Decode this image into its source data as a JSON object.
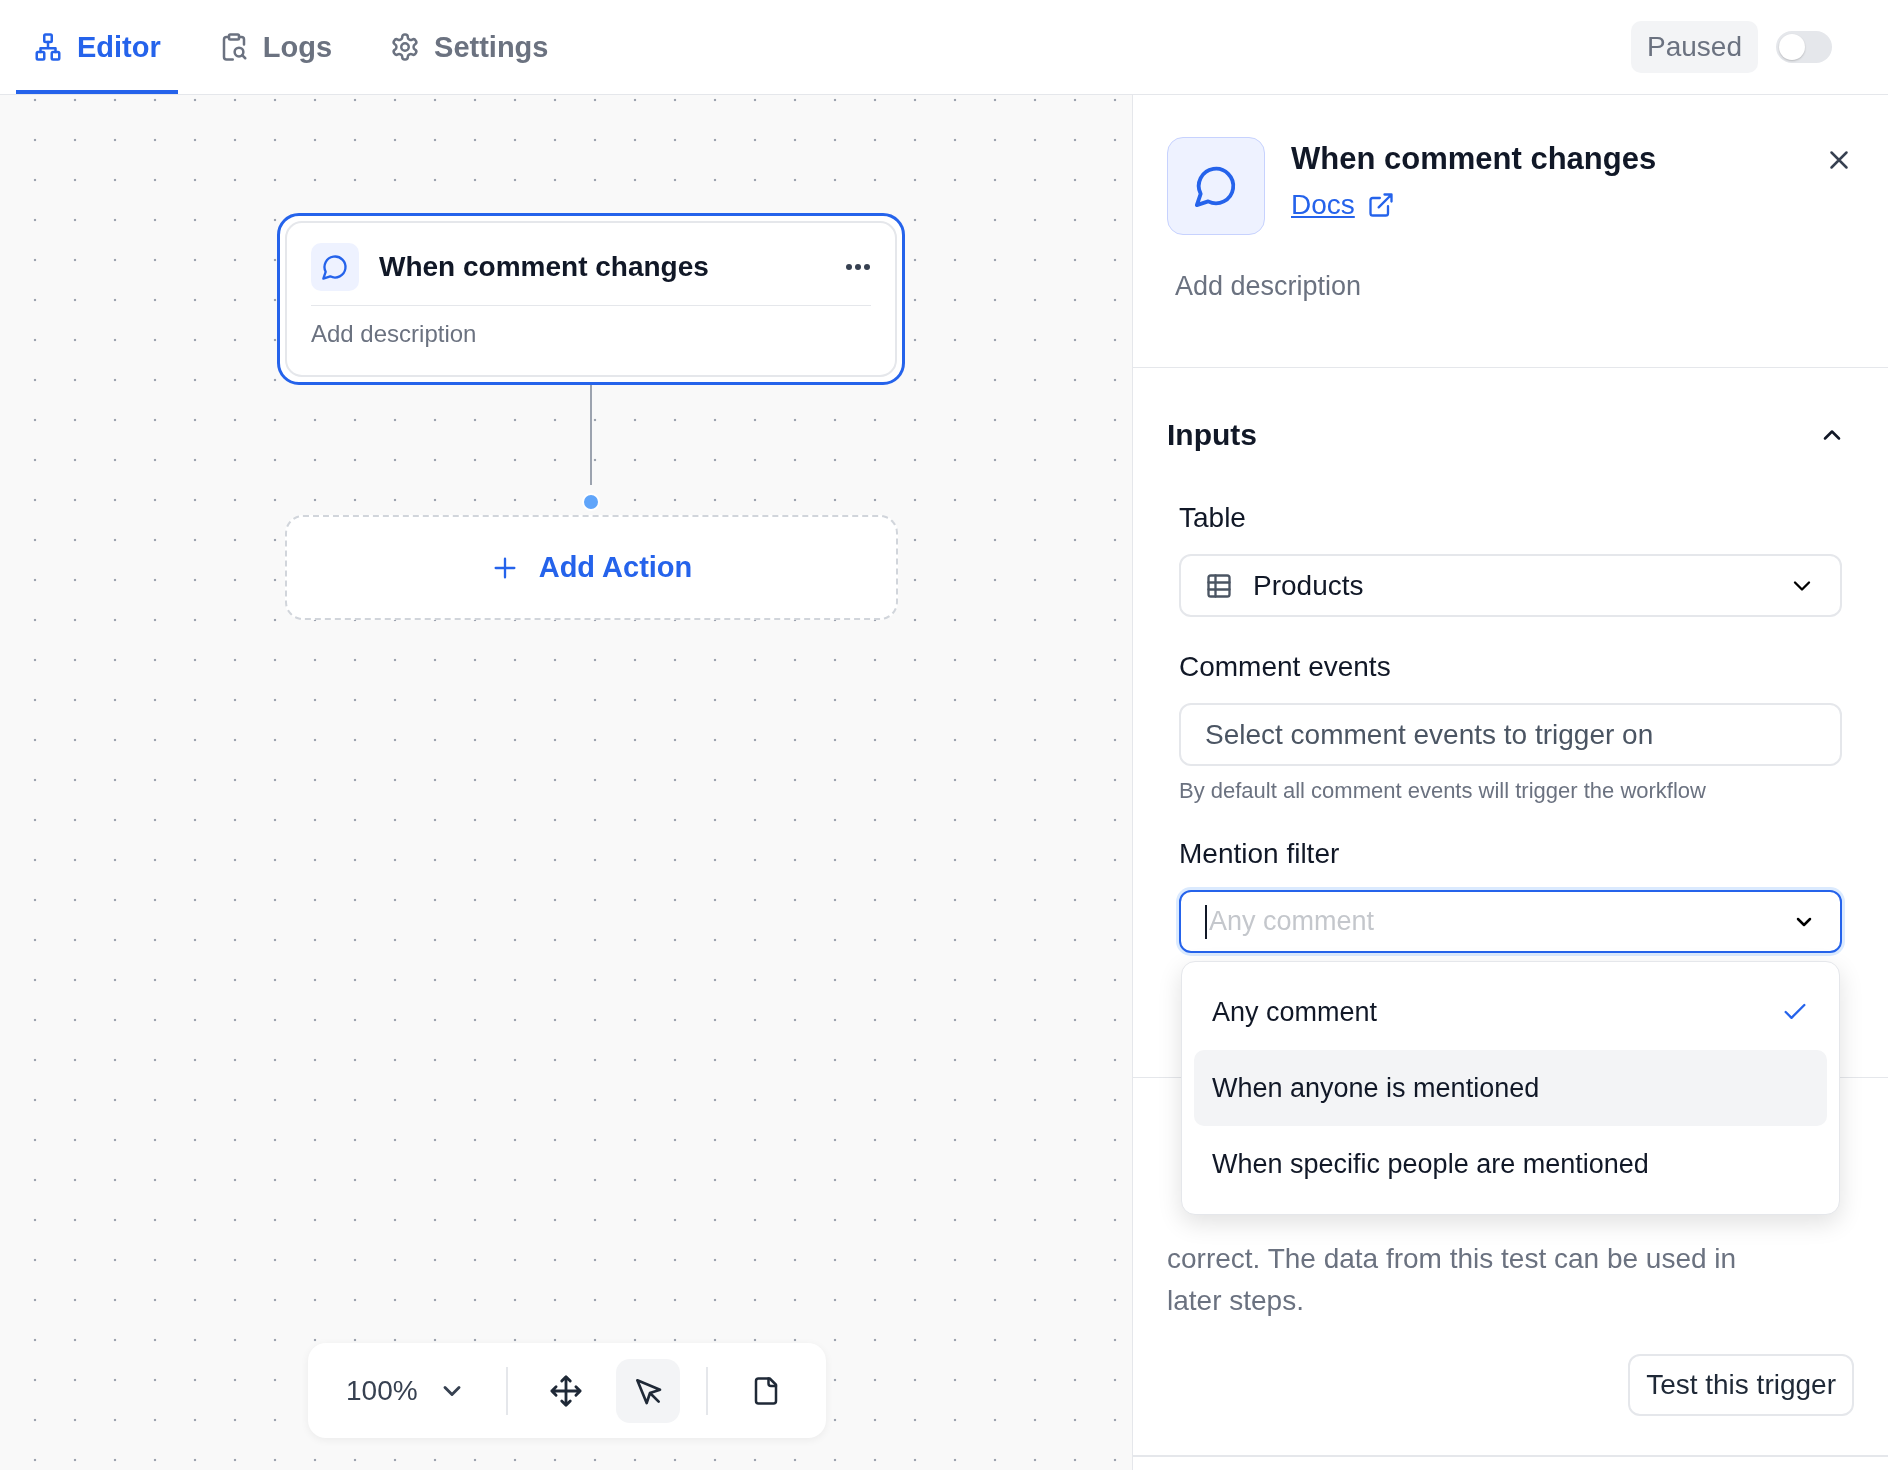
{
  "tabs": [
    {
      "label": "Editor",
      "selected": true
    },
    {
      "label": "Logs",
      "selected": false
    },
    {
      "label": "Settings",
      "selected": false
    }
  ],
  "status": {
    "label": "Paused",
    "toggle_on": false
  },
  "canvas": {
    "trigger_node": {
      "title": "When comment changes",
      "description": "Add description",
      "selected": true
    },
    "add_action": {
      "label": "Add Action"
    },
    "toolbar": {
      "zoom": "100%",
      "tools": [
        {
          "selected": false
        },
        {
          "selected": true
        },
        {
          "selected": false
        }
      ]
    }
  },
  "panel": {
    "title": "When comment changes",
    "docs_link": "Docs",
    "description_placeholder": "Add description",
    "section": {
      "title": "Inputs",
      "expanded": true,
      "fields": [
        {
          "kind": "select",
          "label": "Table",
          "value": "Products",
          "focused": false
        },
        {
          "kind": "multiselect",
          "label": "Comment events",
          "placeholder": "Select comment events to trigger on",
          "help": "By default all comment events will trigger the workflow",
          "focused": false
        },
        {
          "kind": "combobox",
          "label": "Mention filter",
          "placeholder": "Any comment",
          "focused": true
        }
      ]
    },
    "dropdown": {
      "options": [
        {
          "label": "Any comment",
          "selected": true,
          "highlighted": false
        },
        {
          "label": "When anyone is mentioned",
          "selected": false,
          "highlighted": true
        },
        {
          "label": "When specific people are mentioned",
          "selected": false,
          "highlighted": false
        }
      ]
    },
    "test": {
      "description": "correct. The data from this test can be used in later steps.",
      "button": "Test this trigger"
    }
  }
}
